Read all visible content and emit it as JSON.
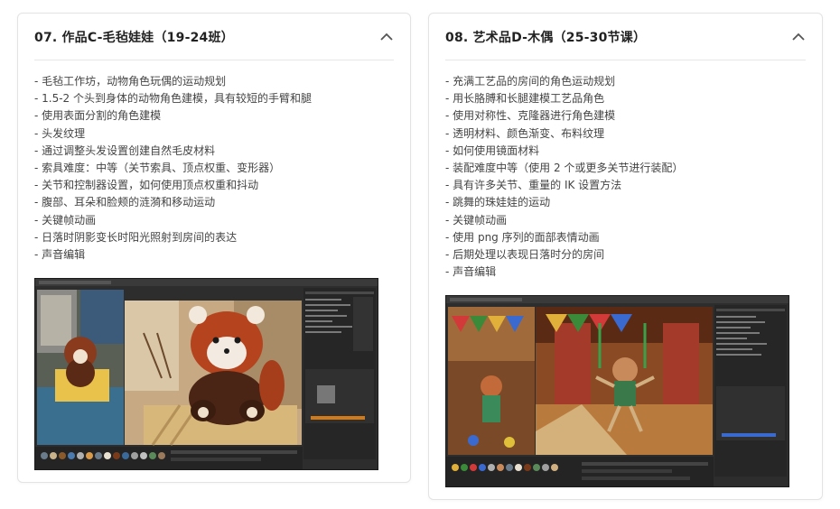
{
  "colors": {
    "card_border": "#e3e3e3",
    "title": "#222222",
    "text": "#444444",
    "divider": "#e6e6e6",
    "editor_bg": "#2b2b2b"
  },
  "cards": [
    {
      "title": "07. 作品C-毛毡娃娃（19-24班）",
      "toggle_icon": "chevron-up-icon",
      "items": [
        "- 毛毡工作坊，动物角色玩偶的运动规划",
        "- 1.5-2 个头到身体的动物角色建模，具有较短的手臂和腿",
        "- 使用表面分割的角色建模",
        "- 头发纹理",
        "- 通过调整头发设置创建自然毛皮材料",
        "- 索具难度：中等（关节索具、顶点权重、变形器）",
        "- 关节和控制器设置，如何使用顶点权重和抖动",
        "- 腹部、耳朵和脸颊的涟漪和移动运动",
        "- 关键帧动画",
        "- 日落时阴影变长时阳光照射到房间的表达",
        "- 声音编辑"
      ],
      "image": "3d-editor-screenshot-red-panda-felt-doll"
    },
    {
      "title": "08. 艺术品D-木偶（25-30节课）",
      "toggle_icon": "chevron-up-icon",
      "items": [
        "- 充满工艺品的房间的角色运动规划",
        "- 用长胳膊和长腿建模工艺品角色",
        "- 使用对称性、克隆器进行角色建模",
        "- 透明材料、颜色渐变、布料纹理",
        "- 如何使用镜面材料",
        "- 装配难度中等（使用 2 个或更多关节进行装配）",
        "- 具有许多关节、重量的 IK 设置方法",
        "- 跳舞的珠娃娃的运动",
        "- 关键帧动画",
        "- 使用 png 序列的面部表情动画",
        "- 后期处理以表现日落时分的房间",
        "- 声音编辑"
      ],
      "image": "3d-editor-screenshot-dancing-marionette"
    }
  ]
}
